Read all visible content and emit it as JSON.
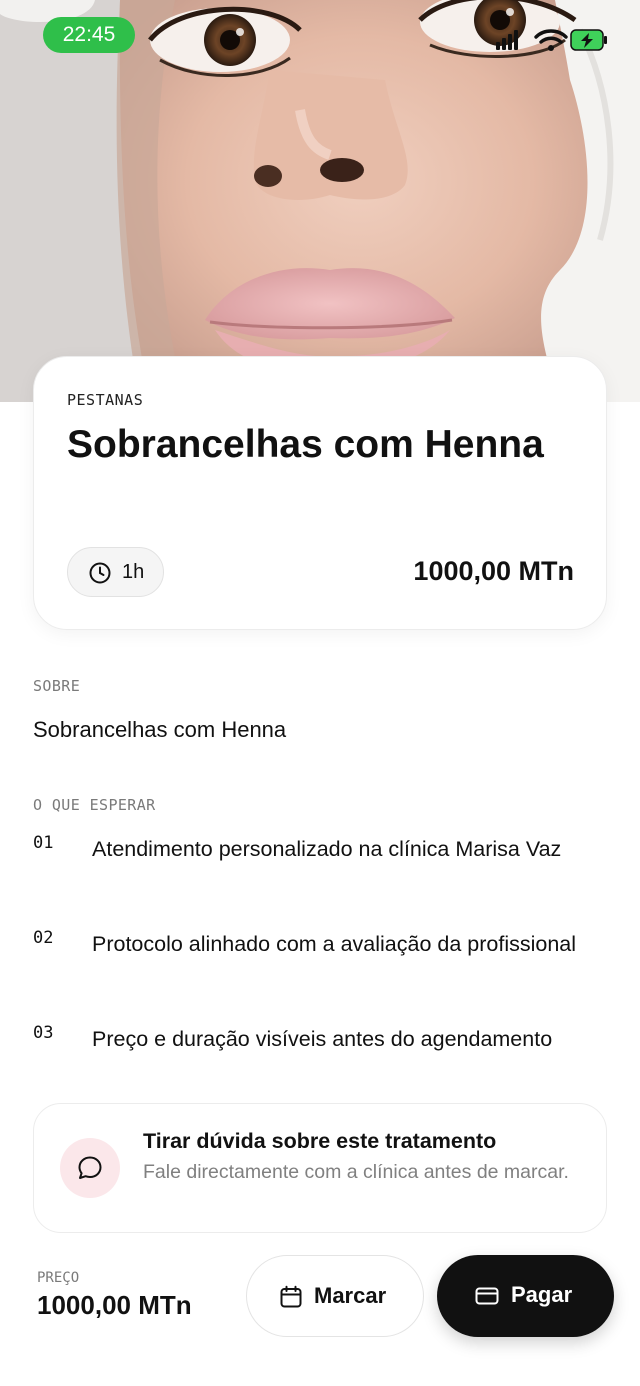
{
  "status_bar": {
    "time": "22:45"
  },
  "hero": {
    "image": "close-up-of-woman-face"
  },
  "service": {
    "category": "PESTANAS",
    "title": "Sobrancelhas com Henna",
    "duration": "1h",
    "price": "1000,00 MTn"
  },
  "about": {
    "label": "SOBRE",
    "text": "Sobrancelhas com Henna"
  },
  "expect": {
    "label": "O QUE ESPERAR",
    "items": [
      {
        "num": "01",
        "text": "Atendimento personalizado na clínica Marisa Vaz"
      },
      {
        "num": "02",
        "text": "Protocolo alinhado com a avaliação da profissional"
      },
      {
        "num": "03",
        "text": "Preço e duração visíveis antes do agendamento"
      }
    ]
  },
  "question": {
    "title": "Tirar dúvida sobre este tratamento",
    "subtitle": "Fale directamente com a clínica antes de marcar."
  },
  "footer": {
    "price_label": "PREÇO",
    "price": "1000,00 MTn",
    "book_label": "Marcar",
    "pay_label": "Pagar"
  },
  "colors": {
    "time_pill": "#2fbf4a",
    "pay_button": "#111111",
    "chat_bubble_bg": "#fbe7ea"
  },
  "icons": [
    "clock-icon",
    "chat-icon",
    "calendar-icon",
    "card-icon",
    "signal-icon",
    "wifi-icon",
    "battery-icon"
  ]
}
